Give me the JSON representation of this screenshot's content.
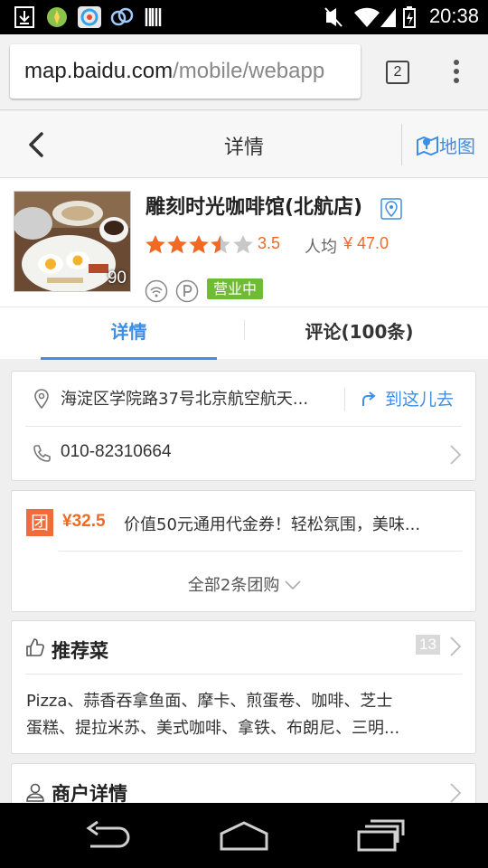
{
  "status_bar": {
    "time": "20:38",
    "left_icons": [
      "download-icon",
      "app-icon-green",
      "app-icon-360",
      "app-icon-nfc",
      "barcode-icon"
    ],
    "right_icons": [
      "mute-icon",
      "wifi-icon",
      "signal-icon",
      "battery-icon"
    ]
  },
  "browser": {
    "url_host": "map.baidu.com",
    "url_path": "/mobile/webapp",
    "tab_count": "2"
  },
  "header": {
    "title": "详情",
    "map_label": "地图"
  },
  "shop": {
    "name": "雕刻时光咖啡馆(北航店)",
    "photo_count": "90",
    "rating_value": 3.5,
    "rating_text": "3.5",
    "avg_label": "人均",
    "avg_price": "¥ 47.0",
    "status_badge": "营业中"
  },
  "tabs": {
    "detail": "详情",
    "review": "评论(100条)"
  },
  "address": {
    "text": "海淀区学院路37号北京航空航天...",
    "goto_label": "到这儿去",
    "phone": "010-82310664"
  },
  "deal": {
    "icon_char": "团",
    "price": "¥32.5",
    "desc": "价值50元通用代金券！轻松氛围，美味...",
    "more": "全部2条团购"
  },
  "dishes": {
    "title": "推荐菜",
    "count": "13",
    "line1": "Pizza、蒜香吞拿鱼面、摩卡、煎蛋卷、咖啡、芝士",
    "line2": "蛋糕、提拉米苏、美式咖啡、拿铁、布朗尼、三明..."
  },
  "merchant": {
    "title": "商户详情"
  },
  "colors": {
    "accent_blue": "#3f8ee6",
    "price_orange": "#f06a25",
    "open_green": "#6fbb33",
    "tuan_orange": "#f26b3a"
  }
}
